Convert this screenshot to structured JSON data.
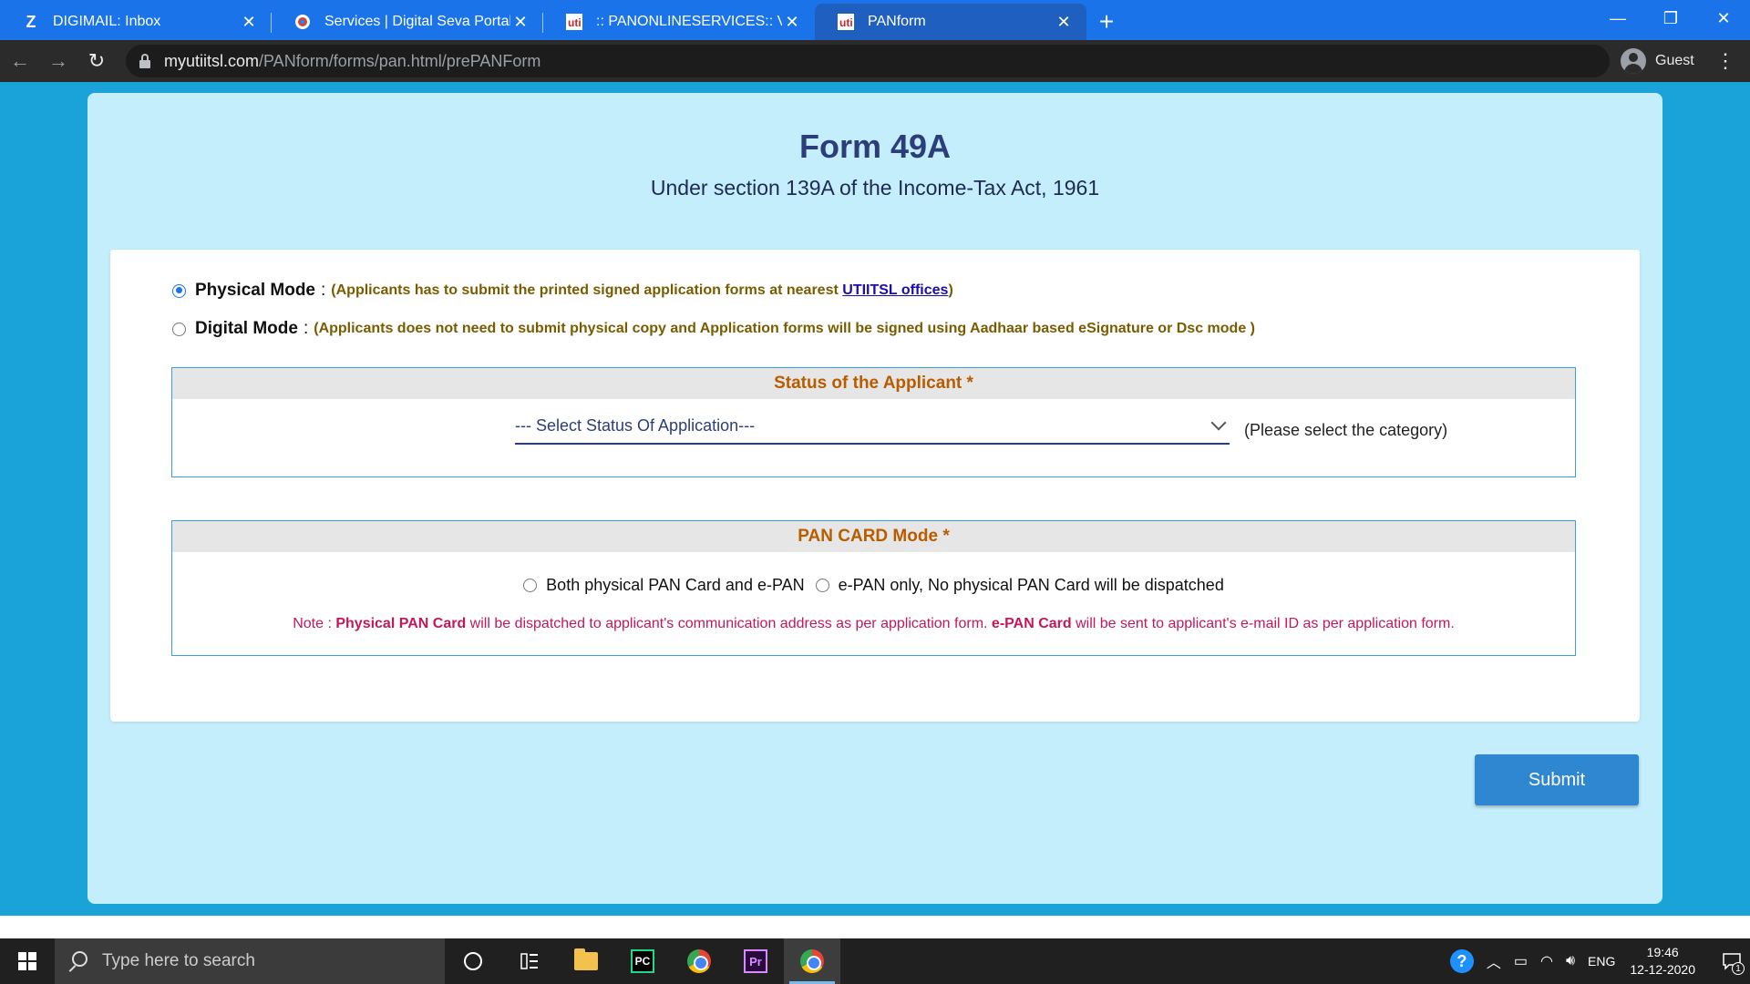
{
  "browser": {
    "tabs": [
      {
        "title": "DIGIMAIL: Inbox",
        "favicon": "Z",
        "active": false
      },
      {
        "title": "Services | Digital Seva Portal - CSC",
        "favicon": "csc-icon",
        "active": false
      },
      {
        "title": ":: PANONLINESERVICES:: Vle Home",
        "favicon": "uti-icon",
        "active": false
      },
      {
        "title": "PANform",
        "favicon": "uti-icon",
        "active": true
      }
    ],
    "url_host": "myutiitsl.com",
    "url_path": "/PANform/forms/pan.html/prePANForm",
    "profile_label": "Guest"
  },
  "form": {
    "title": "Form 49A",
    "subtitle": "Under section 139A of the Income-Tax Act, 1961",
    "physical_mode": {
      "label": "Physical Mode",
      "colon": ":",
      "desc_before": "(Applicants has to submit the printed signed application forms at nearest",
      "link": "UTIITSL offices",
      "desc_after": ")",
      "checked": true
    },
    "digital_mode": {
      "label": "Digital Mode",
      "colon": ":",
      "desc": "(Applicants does not need to submit physical copy and Application forms will be signed using Aadhaar based eSignature or Dsc mode )",
      "checked": false
    },
    "status_section": {
      "heading": "Status of the Applicant *",
      "select_value": "--- Select Status Of Application---",
      "hint": "(Please select the category)"
    },
    "pan_mode_section": {
      "heading": "PAN CARD Mode *",
      "option1": "Both physical PAN Card and e-PAN",
      "option2": "e-PAN only, No physical PAN Card will be dispatched",
      "note_prefix": "Note :",
      "note_b1": "Physical PAN Card",
      "note_mid": "will be dispatched to applicant's communication address as per application form.",
      "note_b2": "e-PAN Card",
      "note_end": "will be sent to applicant's e-mail ID as per application form."
    },
    "submit_label": "Submit"
  },
  "taskbar": {
    "search_placeholder": "Type here to search",
    "language": "ENG",
    "time": "19:46",
    "date": "12-12-2020",
    "notification_count": "1"
  },
  "colors": {
    "tabbar": "#1a73e8",
    "page_bg": "#1aa3d9",
    "card_bg": "#c4eefc",
    "title": "#2c3e7a",
    "section_heading": "#b85c00",
    "note": "#c2185b",
    "submit": "#2f86d1"
  }
}
